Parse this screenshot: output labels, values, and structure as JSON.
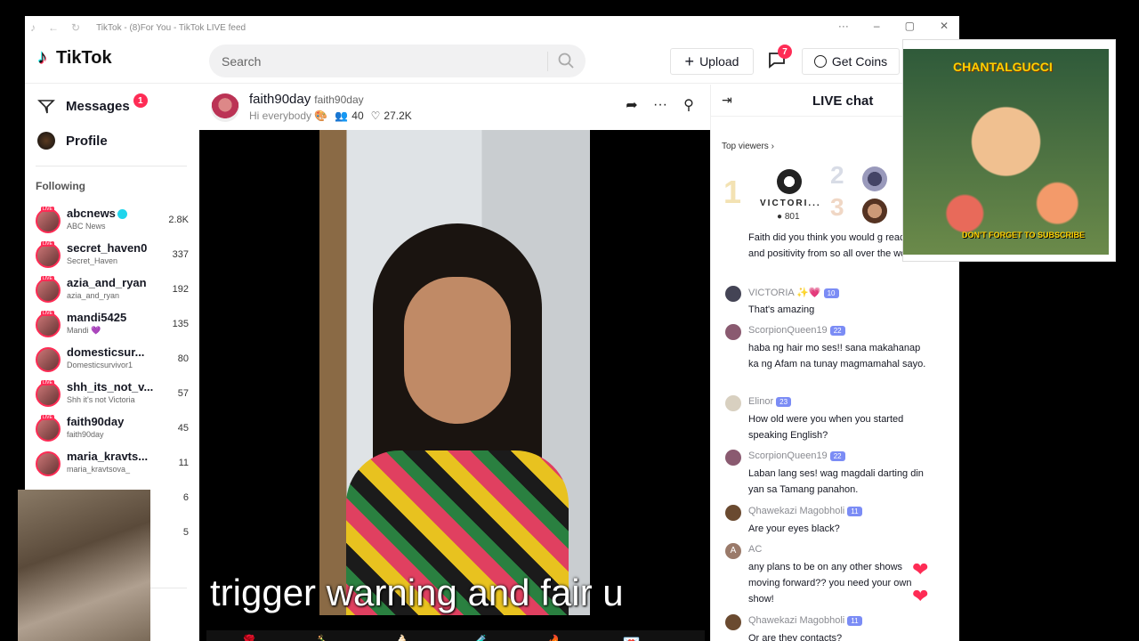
{
  "window": {
    "title": "TikTok - (8)For You - TikTok LIVE feed",
    "controls": [
      "···",
      "–",
      "▢",
      "✕"
    ]
  },
  "header": {
    "logo": "TikTok",
    "search_placeholder": "Search",
    "upload_label": "Upload",
    "inbox_badge": "7",
    "coins_label": "Get Coins"
  },
  "sidebar": {
    "messages_label": "Messages",
    "messages_badge": "1",
    "profile_label": "Profile",
    "following_label": "Following",
    "following": [
      {
        "name": "abcnews",
        "sub": "ABC News",
        "count": "2.8K",
        "verified": true
      },
      {
        "name": "secret_haven0",
        "sub": "Secret_Haven",
        "count": "337"
      },
      {
        "name": "azia_and_ryan",
        "sub": "azia_and_ryan",
        "count": "192"
      },
      {
        "name": "mandi5425",
        "sub": "Mandi 💜",
        "count": "135"
      },
      {
        "name": "domesticsur...",
        "sub": "Domesticsurvivor1",
        "count": "80"
      },
      {
        "name": "shh_its_not_v...",
        "sub": "Shh it's not Victoria",
        "count": "57"
      },
      {
        "name": "faith90day",
        "sub": "faith90day",
        "count": "45"
      },
      {
        "name": "maria_kravts...",
        "sub": "maria_kravtsova_",
        "count": "11"
      },
      {
        "name": "",
        "sub": "",
        "count": "6"
      },
      {
        "name": "",
        "sub": "",
        "count": "5"
      }
    ]
  },
  "stream": {
    "host_name": "faith90day",
    "host_handle": "faith90day",
    "title": "Hi everybody 🎨",
    "viewers": "40",
    "likes": "27.2K",
    "caption": "trigger warning and fair u",
    "gifts": [
      "🌹",
      "🍾",
      "🍦",
      "🧪",
      "🔥",
      "💌"
    ]
  },
  "chat": {
    "title": "LIVE chat",
    "top_viewers_label": "Top viewers",
    "top_viewer_name": "VICTORI...",
    "top_viewer_coins": "801",
    "ranks": [
      "1",
      "2",
      "3"
    ],
    "messages": [
      {
        "user": "",
        "text": "Faith did you think you would g reaction and positivity from so all over the world?"
      },
      {
        "user": "VICTORIA ✨💗",
        "level": "10",
        "text": "That's amazing"
      },
      {
        "user": "ScorpionQueen19",
        "level": "22",
        "text": "haba ng hair mo ses!! sana makahanap ka ng Afam na tunay magmamahal sayo."
      },
      {
        "user": "Elinor",
        "level": "23",
        "text": "How old were you when you started speaking English?"
      },
      {
        "user": "ScorpionQueen19",
        "level": "22",
        "text": "Laban lang ses! wag magdali darting din yan sa Tamang panahon."
      },
      {
        "user": "Qhawekazi Magobholi",
        "level": "11",
        "text": "Are your eyes black?"
      },
      {
        "user": "AC",
        "text": "any plans to be on any other shows moving forward?? you need your own show!"
      },
      {
        "user": "Qhawekazi Magobholi",
        "level": "11",
        "text": "Or are they contacts?"
      }
    ]
  },
  "overlay": {
    "cat_title": "CHANTALGUCCI",
    "cat_sub": "DON'T FORGET TO SUBSCRIBE"
  },
  "colors": {
    "accent": "#fe2c55",
    "verified": "#20d5ec",
    "level": "#7b8cf5"
  }
}
